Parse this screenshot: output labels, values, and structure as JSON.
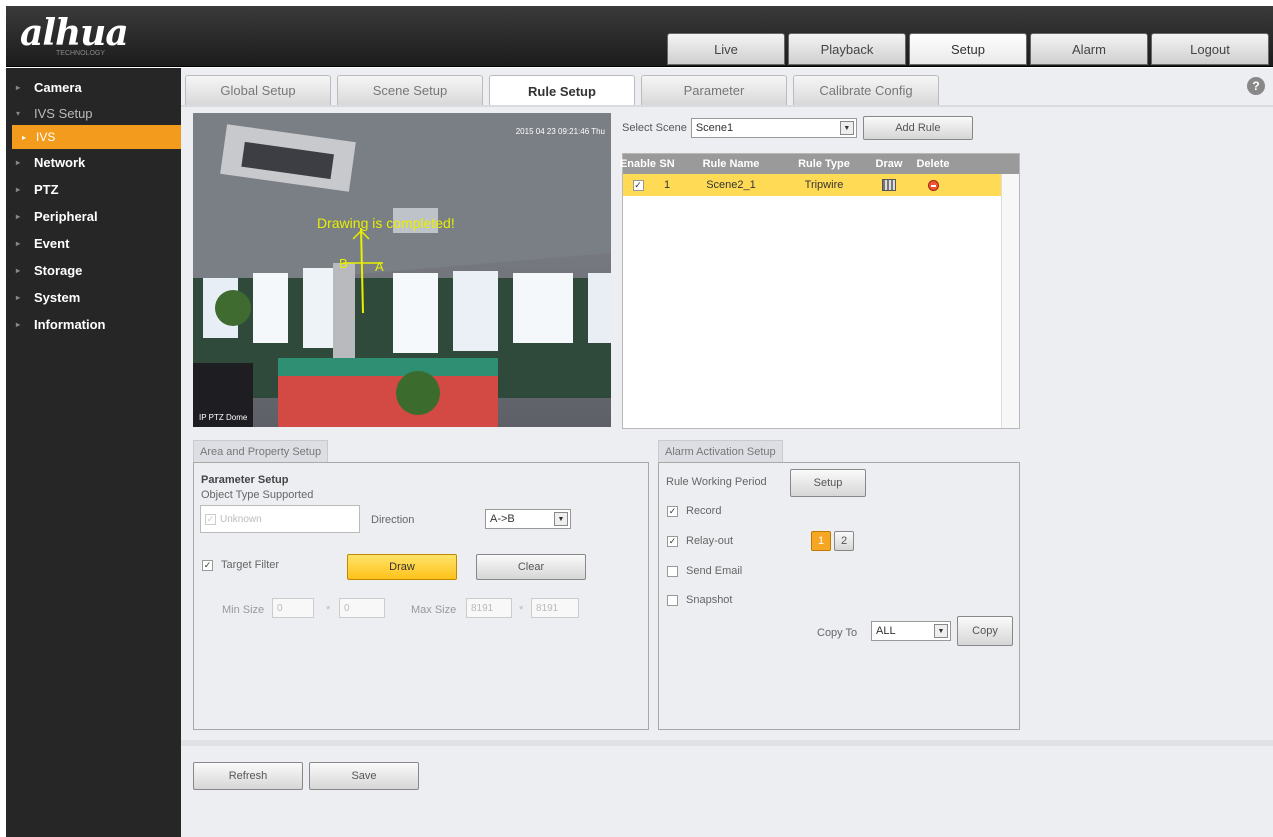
{
  "header": {
    "logo": "alhua",
    "logo_sub": "TECHNOLOGY",
    "nav": [
      "Live",
      "Playback",
      "Setup",
      "Alarm",
      "Logout"
    ],
    "active_nav": "Setup"
  },
  "sidebar": {
    "items": [
      {
        "label": "Camera"
      },
      {
        "label": "IVS Setup"
      },
      {
        "label": "IVS"
      },
      {
        "label": "Network"
      },
      {
        "label": "PTZ"
      },
      {
        "label": "Peripheral"
      },
      {
        "label": "Event"
      },
      {
        "label": "Storage"
      },
      {
        "label": "System"
      },
      {
        "label": "Information"
      }
    ]
  },
  "tabs": {
    "items": [
      "Global Setup",
      "Scene Setup",
      "Rule Setup",
      "Parameter",
      "Calibrate Config"
    ],
    "active": "Rule Setup",
    "help": "?"
  },
  "video": {
    "timestamp": "2015 04 23 09:21:46 Thu",
    "overlay_status": "Drawing is completed!",
    "point_a": "A",
    "point_b": "B",
    "camera_label": "IP PTZ Dome"
  },
  "rules": {
    "select_scene_label": "Select Scene",
    "selected_scene": "Scene1",
    "add_rule_label": "Add Rule",
    "columns": [
      "Enable",
      "SN",
      "Rule Name",
      "Rule Type",
      "Draw",
      "Delete"
    ],
    "rows": [
      {
        "enabled": "✓",
        "sn": "1",
        "name": "Scene2_1",
        "type": "Tripwire"
      }
    ]
  },
  "area": {
    "legend": "Area and Property Setup",
    "section_title": "Parameter Setup",
    "object_type_label": "Object Type Supported",
    "object_type_value": "Unknown",
    "direction_label": "Direction",
    "direction_value": "A->B",
    "target_filter_label": "Target Filter",
    "draw_label": "Draw",
    "clear_label": "Clear",
    "min_size_label": "Min Size",
    "min_w": "0",
    "min_h": "0",
    "max_size_label": "Max Size",
    "max_w": "8191",
    "max_h": "8191",
    "times": "*"
  },
  "alarm": {
    "legend": "Alarm Activation Setup",
    "working_period_label": "Rule Working Period",
    "setup_label": "Setup",
    "record_label": "Record",
    "relay_label": "Relay-out",
    "relay_1": "1",
    "relay_2": "2",
    "email_label": "Send Email",
    "snapshot_label": "Snapshot",
    "copy_to_label": "Copy To",
    "copy_to_value": "ALL",
    "copy_label": "Copy",
    "check_mark": "✓"
  },
  "footer": {
    "refresh_label": "Refresh",
    "save_label": "Save"
  },
  "colors": {
    "accent": "#f39b1c",
    "selected_row": "#ffdb55",
    "draw_button": "#ffd23a"
  }
}
